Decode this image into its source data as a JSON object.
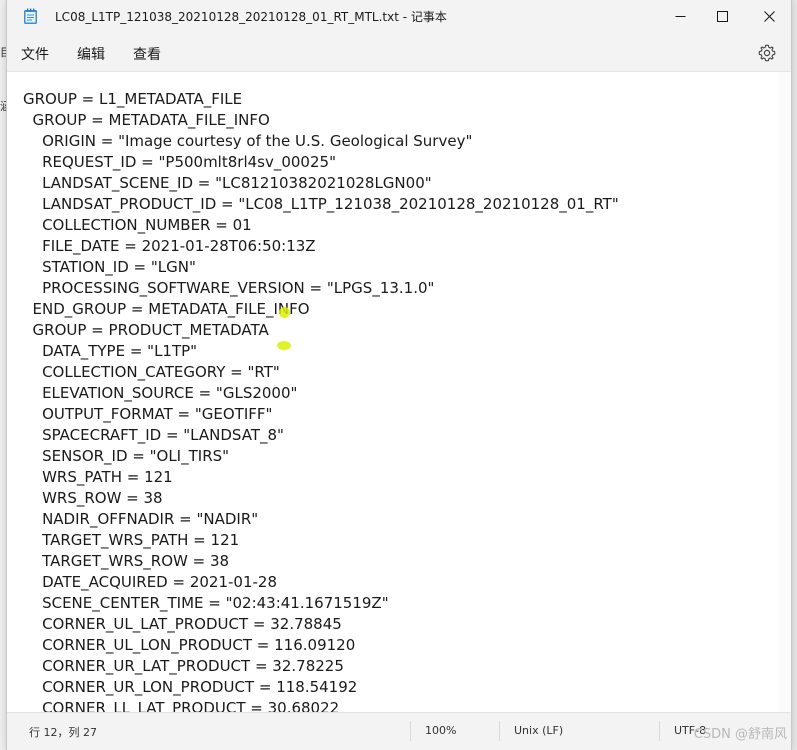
{
  "window": {
    "title": "LC08_L1TP_121038_20210128_20210128_01_RT_MTL.txt - 记事本"
  },
  "icons": {
    "app": "notepad-icon",
    "minimize": "minimize-icon",
    "maximize": "maximize-icon",
    "close": "close-icon",
    "settings": "gear-icon"
  },
  "menu": {
    "file": "文件",
    "edit": "编辑",
    "view": "查看"
  },
  "editor": {
    "lines": [
      "GROUP = L1_METADATA_FILE",
      "  GROUP = METADATA_FILE_INFO",
      "    ORIGIN = \"Image courtesy of the U.S. Geological Survey\"",
      "    REQUEST_ID = \"P500mlt8rl4sv_00025\"",
      "    LANDSAT_SCENE_ID = \"LC81210382021028LGN00\"",
      "    LANDSAT_PRODUCT_ID = \"LC08_L1TP_121038_20210128_20210128_01_RT\"",
      "    COLLECTION_NUMBER = 01",
      "    FILE_DATE = 2021-01-28T06:50:13Z",
      "    STATION_ID = \"LGN\"",
      "    PROCESSING_SOFTWARE_VERSION = \"LPGS_13.1.0\"",
      "  END_GROUP = METADATA_FILE_INFO",
      "  GROUP = PRODUCT_METADATA",
      "    DATA_TYPE = \"L1TP\"",
      "    COLLECTION_CATEGORY = \"RT\"",
      "    ELEVATION_SOURCE = \"GLS2000\"",
      "    OUTPUT_FORMAT = \"GEOTIFF\"",
      "    SPACECRAFT_ID = \"LANDSAT_8\"",
      "    SENSOR_ID = \"OLI_TIRS\"",
      "    WRS_PATH = 121",
      "    WRS_ROW = 38",
      "    NADIR_OFFNADIR = \"NADIR\"",
      "    TARGET_WRS_PATH = 121",
      "    TARGET_WRS_ROW = 38",
      "    DATE_ACQUIRED = 2021-01-28",
      "    SCENE_CENTER_TIME = \"02:43:41.1671519Z\"",
      "    CORNER_UL_LAT_PRODUCT = 32.78845",
      "    CORNER_UL_LON_PRODUCT = 116.09120",
      "    CORNER_UR_LAT_PRODUCT = 32.78225",
      "    CORNER_UR_LON_PRODUCT = 118.54192",
      "    CORNER_LL_LAT_PRODUCT = 30.68022"
    ]
  },
  "status": {
    "position": "行 12，列 27",
    "zoom": "100%",
    "line_ending": "Unix (LF)",
    "encoding": "UTF-8"
  },
  "watermark": "CSDN @舒南风",
  "colors": {
    "titlebar": "#f3f3f3",
    "editor_bg": "#ffffff",
    "text": "#1a1a1a",
    "highlight": "#d8f000"
  }
}
